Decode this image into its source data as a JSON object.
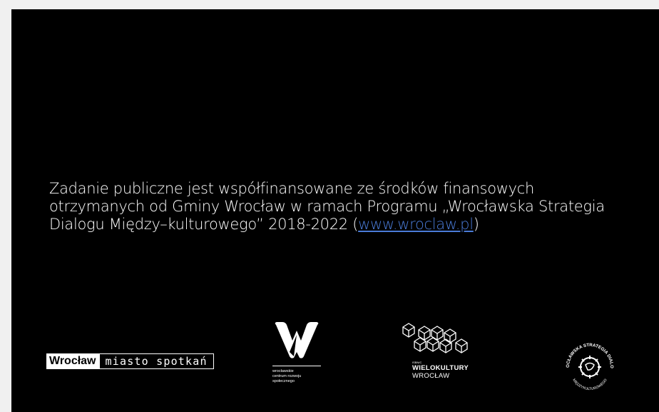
{
  "slide": {
    "text_before_link": "Zadanie publiczne jest współfinansowane ze środków  finansowych otrzymanych od Gminy Wrocław w ramach Programu „Wrocławska Strategia Dialogu Między–kulturowego” 2018-2022 (",
    "link_text": "www.wroclaw.pl",
    "text_after_link": ")"
  },
  "logos": {
    "wroclaw": {
      "left": "Wrocław",
      "right": "miasto spotkań"
    },
    "wcrs": {
      "text": [
        "wrocławskie",
        "centrum rozwoju",
        "społecznego"
      ]
    },
    "wielokultury": {
      "small": "ISBN/C",
      "big": "WIELOKULTURY",
      "city": "WROCŁAW"
    },
    "strategy": {
      "top": "WROCŁAWSKA STRATEGIA DIALOGU",
      "bottom": "MIĘDZYKULTUROWEGO"
    }
  },
  "colors": {
    "background": "#000000",
    "text": "#ffffff",
    "link": "#4a7bd8"
  }
}
